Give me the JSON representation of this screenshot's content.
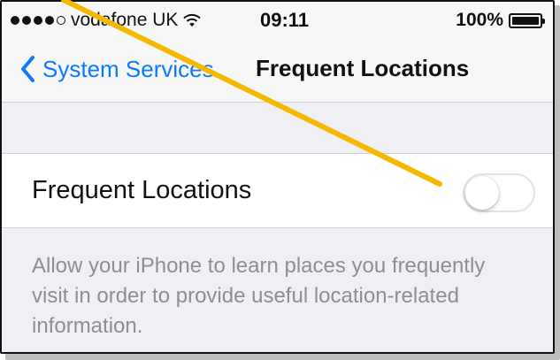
{
  "status_bar": {
    "carrier": "vodafone UK",
    "time": "09:11",
    "battery": "100%"
  },
  "nav": {
    "back_label": "System Services",
    "title": "Frequent Locations"
  },
  "setting": {
    "label": "Frequent Locations",
    "enabled": false
  },
  "footer_text": "Allow your iPhone to learn places you frequently visit in order to provide useful location-related information.",
  "colors": {
    "accent": "#0a7aff",
    "annotation_arrow": "#f5b800",
    "secondary_text": "#8e8e93"
  }
}
